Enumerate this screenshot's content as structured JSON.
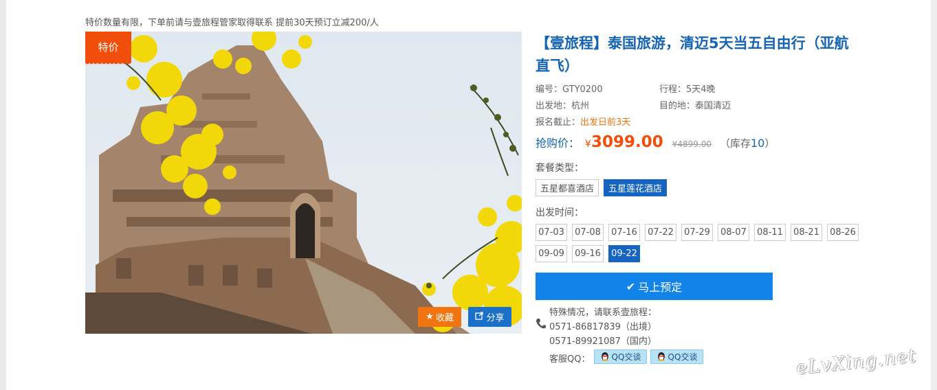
{
  "notice": "特价数量有限，下单前请与壹旅程管家取得联系 提前30天预订立减200/人",
  "badge": "特价",
  "photo_buttons": {
    "favorite": "收藏",
    "share": "分享"
  },
  "product": {
    "title": "【壹旅程】泰国旅游，清迈5天当五自由行（亚航直飞）",
    "code_label": "编号：",
    "code": "GTY0200",
    "duration_label": "行程：",
    "duration": "5天4晚",
    "departure_label": "出发地：",
    "departure": "杭州",
    "destination_label": "目的地：",
    "destination": "泰国清迈",
    "deadline_label": "报名截止：",
    "deadline": "出发日前3天"
  },
  "price": {
    "label": "抢购价：",
    "currency": "¥",
    "current": "3099.00",
    "original": "¥4899.00",
    "stock_prefix": "（库存",
    "stock": "10",
    "stock_suffix": "）"
  },
  "package": {
    "label": "套餐类型：",
    "options": [
      "五星都喜酒店",
      "五星莲花酒店"
    ],
    "selected": "五星莲花酒店"
  },
  "dates": {
    "label": "出发时间：",
    "options": [
      "07-03",
      "07-08",
      "07-16",
      "07-22",
      "07-29",
      "08-07",
      "08-11",
      "08-21",
      "08-26",
      "09-09",
      "09-16",
      "09-22"
    ],
    "selected": "09-22"
  },
  "book_button": "马上预定",
  "contact": {
    "intro": "特殊情况，请联系壹旅程：",
    "phone1": "0571-86817839（出境）",
    "phone2": "0571-89921087（国内）",
    "qq_label": "客服QQ：",
    "qq_buttons": [
      "QQ交谈",
      "QQ交谈"
    ]
  },
  "watermark": "eLvXing.net",
  "colors": {
    "brand_blue": "#1564b3",
    "accent_orange": "#f04e0a",
    "button_blue": "#1283e8"
  },
  "icons": [
    "star-icon",
    "share-icon",
    "check-icon",
    "phone-icon",
    "qq-penguin-icon"
  ]
}
